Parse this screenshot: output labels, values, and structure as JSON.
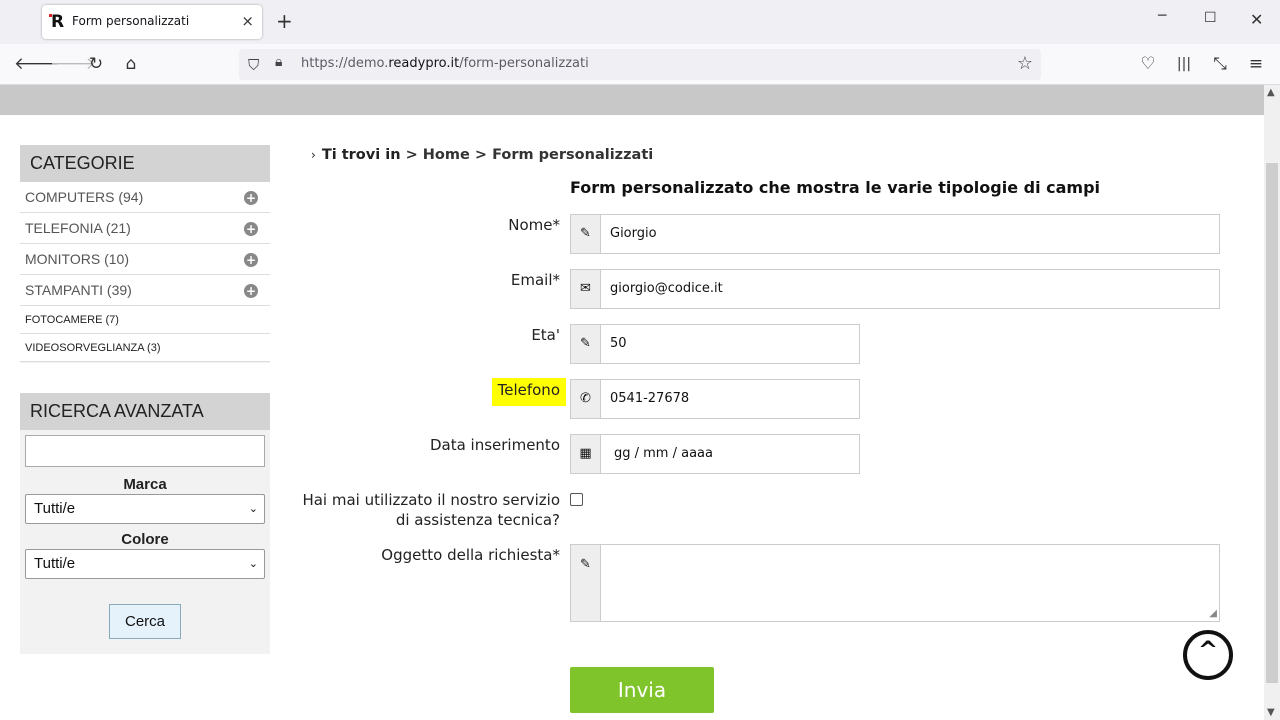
{
  "browser": {
    "tab_title": "Form personalizzati",
    "tab_close": "×",
    "new_tab": "+",
    "favicon_letter": "R",
    "url_prefix": "https://demo.",
    "url_domain": "readypro.it",
    "url_path": "/form-personalizzati",
    "window_controls": [
      "minimize-icon",
      "maximize-icon",
      "close-icon"
    ]
  },
  "sidebar": {
    "categories_title": "CATEGORIE",
    "categories": [
      {
        "label": "COMPUTERS (94)",
        "expandable": true
      },
      {
        "label": "TELEFONIA (21)",
        "expandable": true
      },
      {
        "label": "MONITORS (10)",
        "expandable": true
      },
      {
        "label": "STAMPANTI (39)",
        "expandable": true
      },
      {
        "label": "FOTOCAMERE (7)",
        "expandable": false
      },
      {
        "label": "VIDEOSORVEGLIANZA (3)",
        "expandable": false
      }
    ],
    "search_title": "RICERCA AVANZATA",
    "search_value": "",
    "brand_label": "Marca",
    "brand_value": "Tutti/e",
    "color_label": "Colore",
    "color_value": "Tutti/e",
    "search_button": "Cerca"
  },
  "breadcrumb": {
    "prefix": "Ti trovi in",
    "path": "> Home > Form personalizzati"
  },
  "form": {
    "title": "Form personalizzato che mostra le varie tipologie di campi",
    "name_label": "Nome*",
    "name_value": "Giorgio",
    "email_label": "Email*",
    "email_value": "giorgio@codice.it",
    "age_label": "Eta'",
    "age_value": "50",
    "phone_label": "Telefono",
    "phone_value": "0541-27678",
    "date_label": "Data inserimento",
    "date_placeholder": "gg / mm / aaaa",
    "service_label_line1": "Hai mai utilizzato il nostro servizio",
    "service_label_line2": "di assistenza tecnica?",
    "service_checked": false,
    "subject_label": "Oggetto della richiesta*",
    "subject_value": "",
    "submit_label": "Invia"
  },
  "colors": {
    "submit_bg": "#7fc42b",
    "highlight": "#ffff00",
    "sidebar_header": "#d3d3d3"
  }
}
